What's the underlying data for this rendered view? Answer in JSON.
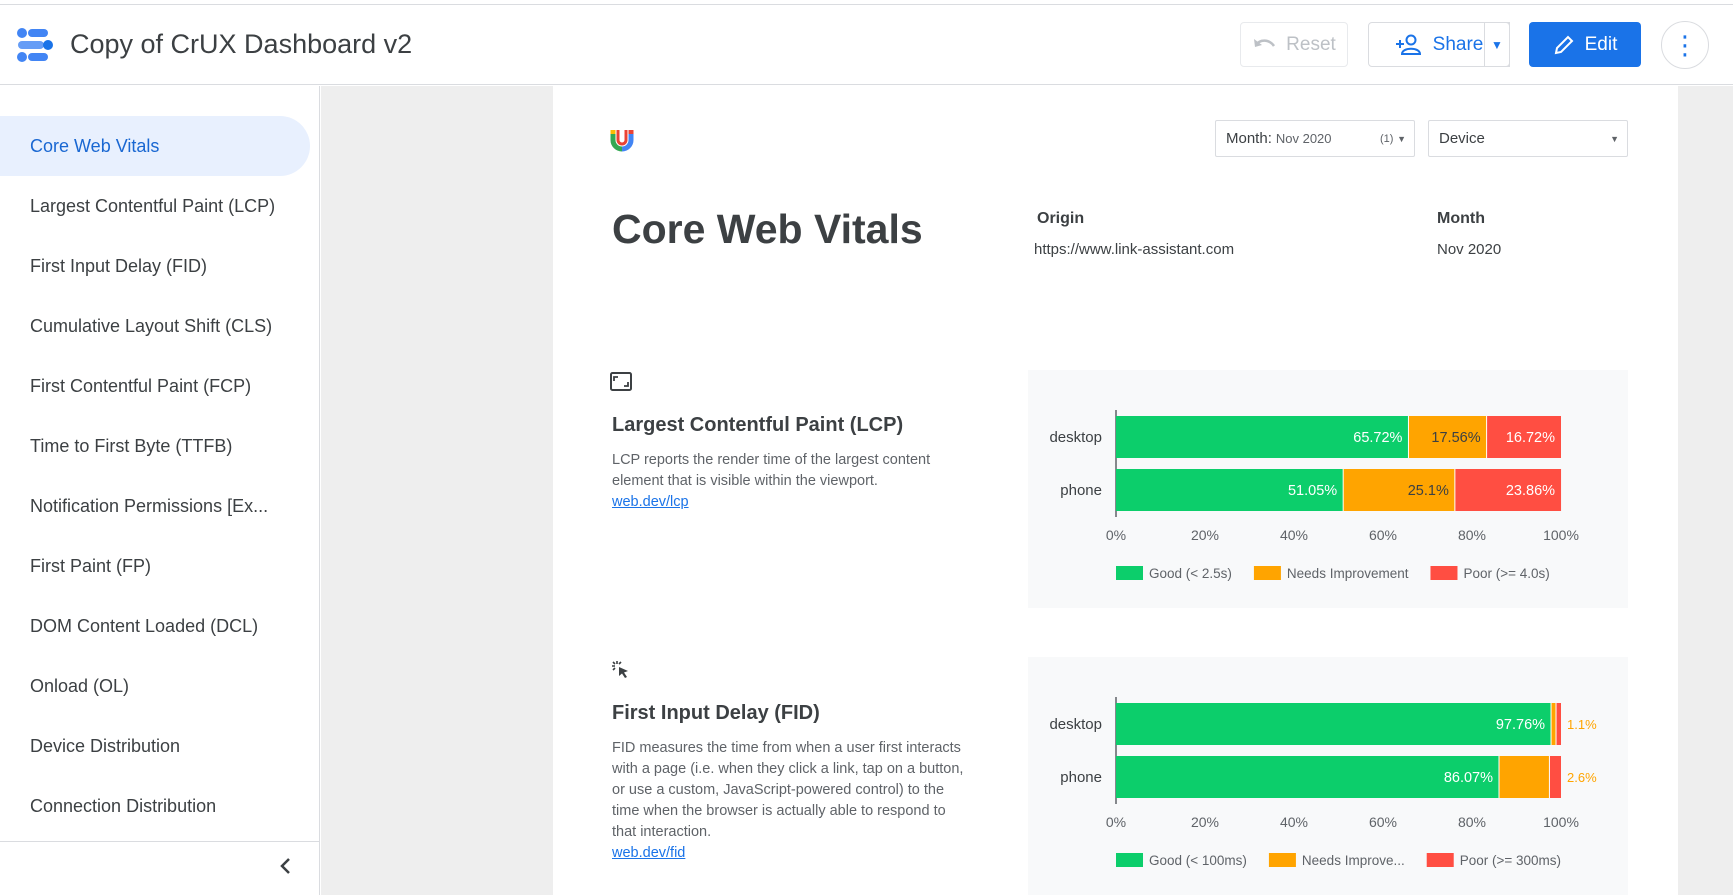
{
  "header": {
    "title": "Copy of CrUX Dashboard v2",
    "reset_label": "Reset",
    "share_label": "Share",
    "edit_label": "Edit"
  },
  "sidebar": {
    "items": [
      {
        "label": "Core Web Vitals",
        "active": true
      },
      {
        "label": "Largest Contentful Paint (LCP)"
      },
      {
        "label": "First Input Delay (FID)"
      },
      {
        "label": "Cumulative Layout Shift (CLS)"
      },
      {
        "label": "First Contentful Paint (FCP)"
      },
      {
        "label": "Time to First Byte (TTFB)"
      },
      {
        "label": "Notification Permissions [Ex..."
      },
      {
        "label": "First Paint (FP)"
      },
      {
        "label": "DOM Content Loaded (DCL)"
      },
      {
        "label": "Onload (OL)"
      },
      {
        "label": "Device Distribution"
      },
      {
        "label": "Connection Distribution"
      }
    ]
  },
  "filters": {
    "month_label": "Month:",
    "month_value": "Nov 2020",
    "month_count": "(1)",
    "device_label": "Device"
  },
  "report": {
    "title": "Core Web Vitals",
    "origin_label": "Origin",
    "origin_value": "https://www.link-assistant.com",
    "month_label": "Month",
    "month_value": "Nov 2020"
  },
  "sections": {
    "lcp": {
      "title": "Largest Contentful Paint (LCP)",
      "description": "LCP reports the render time of the largest content element that is visible within the viewport.",
      "link": "web.dev/lcp"
    },
    "fid": {
      "title": "First Input Delay (FID)",
      "description": "FID measures the time from when a user first interacts with a page (i.e. when they click a link, tap on a button, or use a custom, JavaScript-powered control) to the time when the browser is actually able to respond to that interaction.",
      "link": "web.dev/fid"
    }
  },
  "colors": {
    "good": "#0cce6b",
    "needs": "#ffa400",
    "poor": "#ff4e42",
    "accent": "#1a73e8"
  },
  "chart_data": [
    {
      "type": "bar",
      "orientation": "horizontal-stacked",
      "categories": [
        "desktop",
        "phone"
      ],
      "series": [
        {
          "name": "Good (< 2.5s)",
          "values": [
            65.72,
            51.05
          ],
          "labels": [
            "65.72%",
            "51.05%"
          ]
        },
        {
          "name": "Needs Improvement",
          "values": [
            17.56,
            25.1
          ],
          "labels": [
            "17.56%",
            "25.1%"
          ]
        },
        {
          "name": "Poor (>= 4.0s)",
          "values": [
            16.72,
            23.86
          ],
          "labels": [
            "16.72%",
            "23.86%"
          ]
        }
      ],
      "xlim": [
        0,
        100
      ],
      "xticks": [
        "0%",
        "20%",
        "40%",
        "60%",
        "80%",
        "100%"
      ],
      "legend": "bottom"
    },
    {
      "type": "bar",
      "orientation": "horizontal-stacked",
      "categories": [
        "desktop",
        "phone"
      ],
      "series": [
        {
          "name": "Good (< 100ms)",
          "values": [
            97.76,
            86.07
          ],
          "labels": [
            "97.76%",
            "86.07%"
          ]
        },
        {
          "name": "Needs Improve...",
          "values": [
            1.12,
            11.33
          ],
          "labels": [
            "",
            ""
          ]
        },
        {
          "name": "Poor (>= 300ms)",
          "values": [
            1.12,
            2.6
          ],
          "labels": [
            "",
            ""
          ]
        }
      ],
      "overflow_labels": [
        "1.1%",
        "2.6%"
      ],
      "xlim": [
        0,
        100
      ],
      "xticks": [
        "0%",
        "20%",
        "40%",
        "60%",
        "80%",
        "100%"
      ],
      "legend": "bottom"
    }
  ]
}
